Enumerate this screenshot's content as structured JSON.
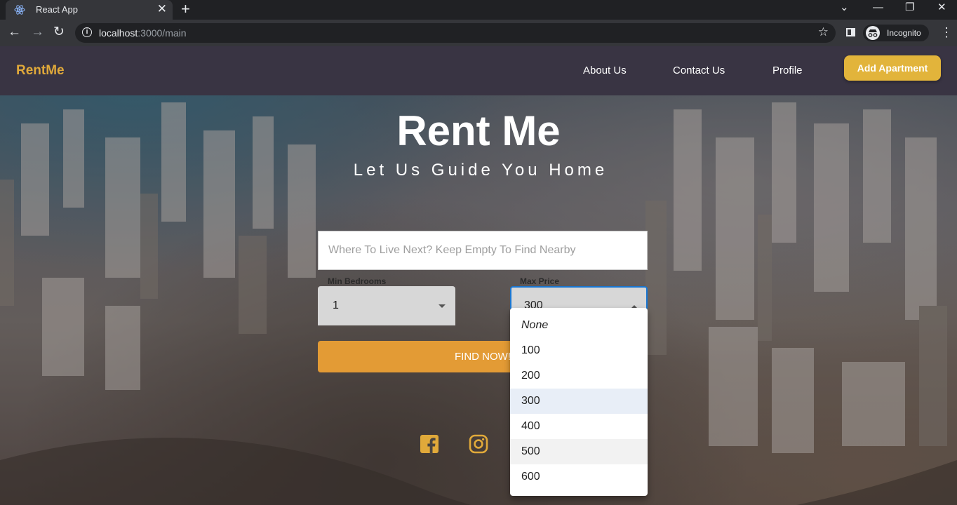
{
  "browser": {
    "tab_title": "React App",
    "tab_close": "✕",
    "new_tab": "+",
    "url_host": "localhost",
    "url_rest": ":3000/main",
    "profile_label": "Incognito"
  },
  "navbar": {
    "brand": "RentMe",
    "links": [
      "About Us",
      "Contact Us",
      "Profile"
    ],
    "cta": "Add Apartment"
  },
  "hero": {
    "title": "Rent Me",
    "subtitle": "Let Us Guide You Home"
  },
  "search": {
    "placeholder": "Where To Live Next? Keep Empty To Find Nearby",
    "min_label": "Min Bedrooms",
    "min_value": "1",
    "max_label": "Max Price",
    "max_value": "300",
    "find_label": "FIND NOW!"
  },
  "dropdown": {
    "options": [
      "None",
      "100",
      "200",
      "300",
      "400",
      "500",
      "600"
    ],
    "selected": "300",
    "hovered": "500"
  },
  "social": [
    "facebook-icon",
    "instagram-icon"
  ],
  "colors": {
    "brand": "#e0a93a",
    "navbar": "#393443",
    "cta": "#e2b43b",
    "find": "#e39b35",
    "focus": "#1976d2"
  }
}
